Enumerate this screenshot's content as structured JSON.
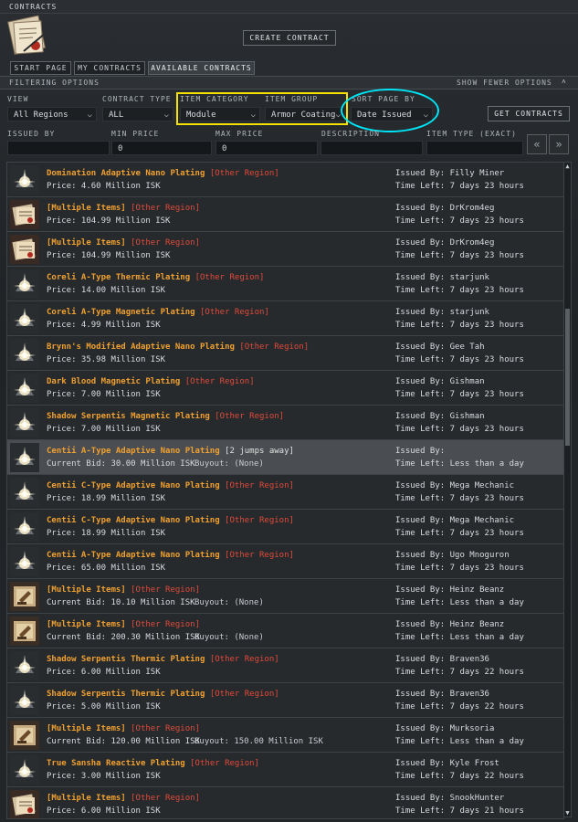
{
  "window": {
    "title": "CONTRACTS"
  },
  "header": {
    "create_label": "CREATE CONTRACT"
  },
  "tabs": [
    {
      "label": "START PAGE"
    },
    {
      "label": "MY CONTRACTS"
    },
    {
      "label": "AVAILABLE CONTRACTS"
    }
  ],
  "filterbar": {
    "title": "FILTERING OPTIONS",
    "toggle": "SHOW FEWER OPTIONS"
  },
  "filters": {
    "view": {
      "label": "VIEW",
      "value": "All Regions"
    },
    "contract_type": {
      "label": "CONTRACT TYPE",
      "value": "ALL"
    },
    "item_category": {
      "label": "ITEM CATEGORY",
      "value": "Module"
    },
    "item_group": {
      "label": "ITEM GROUP",
      "value": "Armor Coating"
    },
    "sort": {
      "label": "SORT PAGE BY",
      "value": "Date Issued"
    },
    "get_label": "GET CONTRACTS",
    "issued_by": {
      "label": "ISSUED BY",
      "value": ""
    },
    "min_price": {
      "label": "MIN PRICE",
      "value": "0"
    },
    "max_price": {
      "label": "MAX PRICE",
      "value": "0"
    },
    "description": {
      "label": "DESCRIPTION",
      "value": ""
    },
    "item_type": {
      "label": "ITEM TYPE (EXACT)",
      "value": ""
    }
  },
  "colors": {
    "item_name": "#f0a030",
    "region": "#e04a3a",
    "highlight_yellow": "#f5e100",
    "highlight_cyan": "#00e5f5"
  },
  "contracts": [
    {
      "icon": "plating-module-icon",
      "name": "Domination Adaptive Nano Plating",
      "region": "[Other Region]",
      "price": "Price: 4.60 Million ISK",
      "buyout": "",
      "issued": "Issued By: Filly Miner",
      "time": "Time Left: 7 days 23 hours"
    },
    {
      "icon": "multiple-items-icon",
      "name": "[Multiple Items]",
      "region": "[Other Region]",
      "price": "Price: 104.99 Million ISK",
      "buyout": "",
      "issued": "Issued By: DrKrom4eg",
      "time": "Time Left: 7 days 23 hours"
    },
    {
      "icon": "multiple-items-icon",
      "name": "[Multiple Items]",
      "region": "[Other Region]",
      "price": "Price: 104.99 Million ISK",
      "buyout": "",
      "issued": "Issued By: DrKrom4eg",
      "time": "Time Left: 7 days 23 hours"
    },
    {
      "icon": "plating-module-icon",
      "name": "Coreli A-Type Thermic Plating",
      "region": "[Other Region]",
      "price": "Price: 14.00 Million ISK",
      "buyout": "",
      "issued": "Issued By: starjunk",
      "time": "Time Left: 7 days 23 hours"
    },
    {
      "icon": "plating-module-icon",
      "name": "Coreli A-Type Magnetic Plating",
      "region": "[Other Region]",
      "price": "Price: 4.99 Million ISK",
      "buyout": "",
      "issued": "Issued By: starjunk",
      "time": "Time Left: 7 days 23 hours"
    },
    {
      "icon": "plating-module-icon",
      "name": "Brynn's Modified Adaptive Nano Plating",
      "region": "[Other Region]",
      "price": "Price: 35.98 Million ISK",
      "buyout": "",
      "issued": "Issued By: Gee Tah",
      "time": "Time Left: 7 days 23 hours"
    },
    {
      "icon": "plating-module-icon",
      "name": "Dark Blood Magnetic Plating",
      "region": "[Other Region]",
      "price": "Price: 7.00 Million ISK",
      "buyout": "",
      "issued": "Issued By: Gishman",
      "time": "Time Left: 7 days 23 hours"
    },
    {
      "icon": "plating-module-icon",
      "name": "Shadow Serpentis Magnetic Plating",
      "region": "[Other Region]",
      "price": "Price: 7.00 Million ISK",
      "buyout": "",
      "issued": "Issued By: Gishman",
      "time": "Time Left: 7 days 23 hours"
    },
    {
      "icon": "plating-module-icon",
      "name": "Centii A-Type Adaptive Nano Plating",
      "region": "",
      "jumps": "[2 jumps away]",
      "price": "Current Bid: 30.00 Million ISK",
      "buyout": "Buyout: (None)",
      "issued": "Issued By:",
      "time": "Time Left: Less than a day",
      "selected": true
    },
    {
      "icon": "plating-module-icon",
      "name": "Centii C-Type Adaptive Nano Plating",
      "region": "[Other Region]",
      "price": "Price: 18.99 Million ISK",
      "buyout": "",
      "issued": "Issued By: Mega Mechanic",
      "time": "Time Left: 7 days 23 hours"
    },
    {
      "icon": "plating-module-icon",
      "name": "Centii C-Type Adaptive Nano Plating",
      "region": "[Other Region]",
      "price": "Price: 18.99 Million ISK",
      "buyout": "",
      "issued": "Issued By: Mega Mechanic",
      "time": "Time Left: 7 days 23 hours"
    },
    {
      "icon": "plating-module-icon",
      "name": "Centii A-Type Adaptive Nano Plating",
      "region": "[Other Region]",
      "price": "Price: 65.00 Million ISK",
      "buyout": "",
      "issued": "Issued By: Ugo Mnoguron",
      "time": "Time Left: 7 days 23 hours"
    },
    {
      "icon": "auction-items-icon",
      "name": "[Multiple Items]",
      "region": "[Other Region]",
      "price": "Current Bid: 10.10 Million ISK",
      "buyout": "Buyout: (None)",
      "issued": "Issued By: Heinz Beanz",
      "time": "Time Left: Less than a day"
    },
    {
      "icon": "auction-items-icon",
      "name": "[Multiple Items]",
      "region": "[Other Region]",
      "price": "Current Bid: 200.30 Million ISK",
      "buyout": "Buyout: (None)",
      "issued": "Issued By: Heinz Beanz",
      "time": "Time Left: Less than a day"
    },
    {
      "icon": "plating-module-icon",
      "name": "Shadow Serpentis Thermic Plating",
      "region": "[Other Region]",
      "price": "Price: 6.00 Million ISK",
      "buyout": "",
      "issued": "Issued By: Braven36",
      "time": "Time Left: 7 days 22 hours"
    },
    {
      "icon": "plating-module-icon",
      "name": "Shadow Serpentis Thermic Plating",
      "region": "[Other Region]",
      "price": "Price: 5.00 Million ISK",
      "buyout": "",
      "issued": "Issued By: Braven36",
      "time": "Time Left: 7 days 22 hours"
    },
    {
      "icon": "auction-items-icon",
      "name": "[Multiple Items]",
      "region": "[Other Region]",
      "price": "Current Bid: 120.00 Million ISK",
      "buyout": "Buyout: 150.00 Million ISK",
      "issued": "Issued By: Murksoria",
      "time": "Time Left: Less than a day"
    },
    {
      "icon": "plating-module-icon",
      "name": "True Sansha Reactive Plating",
      "region": "[Other Region]",
      "price": "Price: 3.00 Million ISK",
      "buyout": "",
      "issued": "Issued By: Kyle Frost",
      "time": "Time Left: 7 days 22 hours"
    },
    {
      "icon": "multiple-items-icon",
      "name": "[Multiple Items]",
      "region": "[Other Region]",
      "price": "Price: 6.00 Million ISK",
      "buyout": "",
      "issued": "Issued By: SnookHunter",
      "time": "Time Left: 7 days 21 hours"
    }
  ]
}
